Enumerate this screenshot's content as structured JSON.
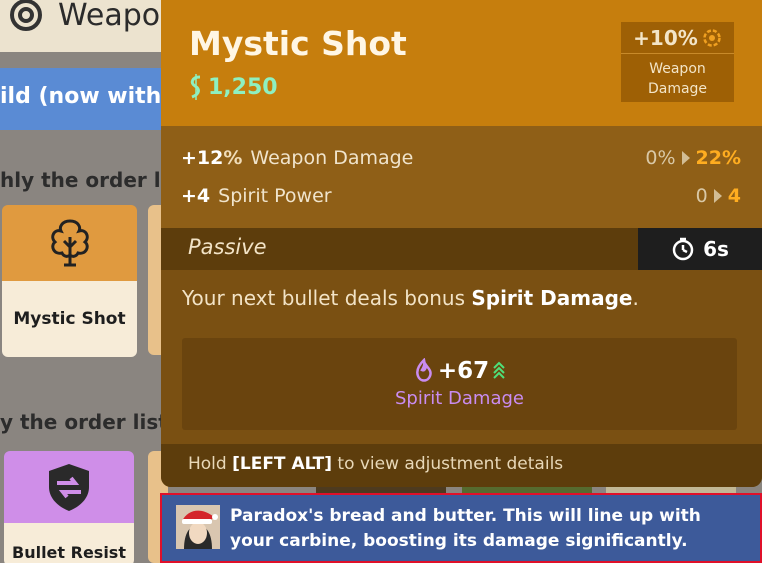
{
  "background": {
    "title": "Weapo",
    "banner_text": "ild (now with",
    "sub_heading_1": "hly the order lis",
    "sub_heading_2": "y the order list",
    "cards": [
      {
        "label": "Mystic Shot",
        "icon": "tree-burst-icon",
        "color": "#e09a3f"
      },
      {
        "label": "Bullet Resist",
        "icon": "shield-arrows-icon",
        "color": "#cf8ee8"
      }
    ]
  },
  "tooltip": {
    "name": "Mystic Shot",
    "cost": "1,250",
    "cost_icon": "souls-icon",
    "badge": {
      "value": "+10%",
      "icon": "weapon-target-icon",
      "label_line1": "Weapon",
      "label_line2": "Damage"
    },
    "stats": [
      {
        "value": "+12",
        "unit": "%",
        "name": "Weapon Damage",
        "from": "0%",
        "to": "22%"
      },
      {
        "value": "+4",
        "unit": "",
        "name": "Spirit Power",
        "from": "0",
        "to": "4"
      }
    ],
    "passive_label": "Passive",
    "cooldown": "6s",
    "cooldown_icon": "stopwatch-icon",
    "description_prefix": "Your next bullet deals bonus ",
    "description_bold": "Spirit Damage",
    "description_suffix": ".",
    "bonus_value": "+67",
    "bonus_label": "Spirit Damage",
    "bonus_icon": "spirit-flame-icon",
    "footer_prefix": "Hold ",
    "footer_key": "[LEFT ALT]",
    "footer_suffix": " to view adjustment details"
  },
  "comment": {
    "text": "Paradox's bread and butter. This will line up with your carbine, boosting its damage significantly."
  },
  "colors": {
    "tooltip_header": "#c67e0d",
    "accent_orange": "#ffad20",
    "spirit_purple": "#c98cf0",
    "souls_green": "#8ef0c0",
    "comment_bg": "#3d5a9a",
    "highlight_border": "#e0102a"
  }
}
